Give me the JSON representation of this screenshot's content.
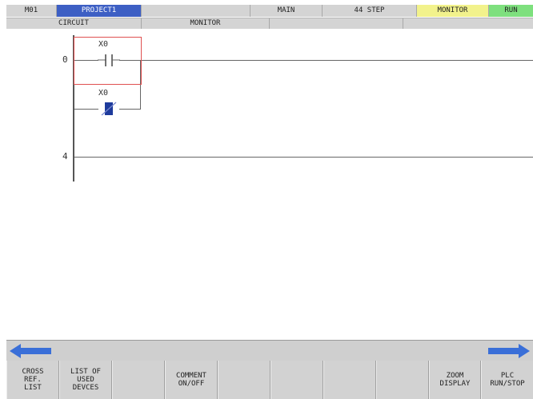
{
  "header": {
    "mode": "M01",
    "project": "PROJECT1",
    "program": "MAIN",
    "steps": "44 STEP",
    "status": "MONITOR",
    "run_state": "RUN",
    "sub_circuit": "CIRCUIT",
    "sub_monitor": "MONITOR"
  },
  "colors": {
    "project_bg": "#3d5fc4",
    "status_bg": "#f2f28c",
    "run_bg": "#7ee07e",
    "arrow": "#3a6fd8",
    "cursor": "#e05050",
    "contact_active": "#1e3b9c"
  },
  "ladder": {
    "step_0": "0",
    "step_4": "4",
    "contact_no_label": "X0",
    "contact_nc_label": "X0"
  },
  "nav": {
    "left_icon": "arrow-left-icon",
    "right_icon": "arrow-right-icon"
  },
  "softkeys": [
    "CROSS\nREF.\nLIST",
    "LIST OF\nUSED\nDEVCES",
    "",
    "COMMENT\nON/OFF",
    "",
    "",
    "",
    "",
    "ZOOM\nDISPLAY",
    "PLC\nRUN/STOP"
  ]
}
